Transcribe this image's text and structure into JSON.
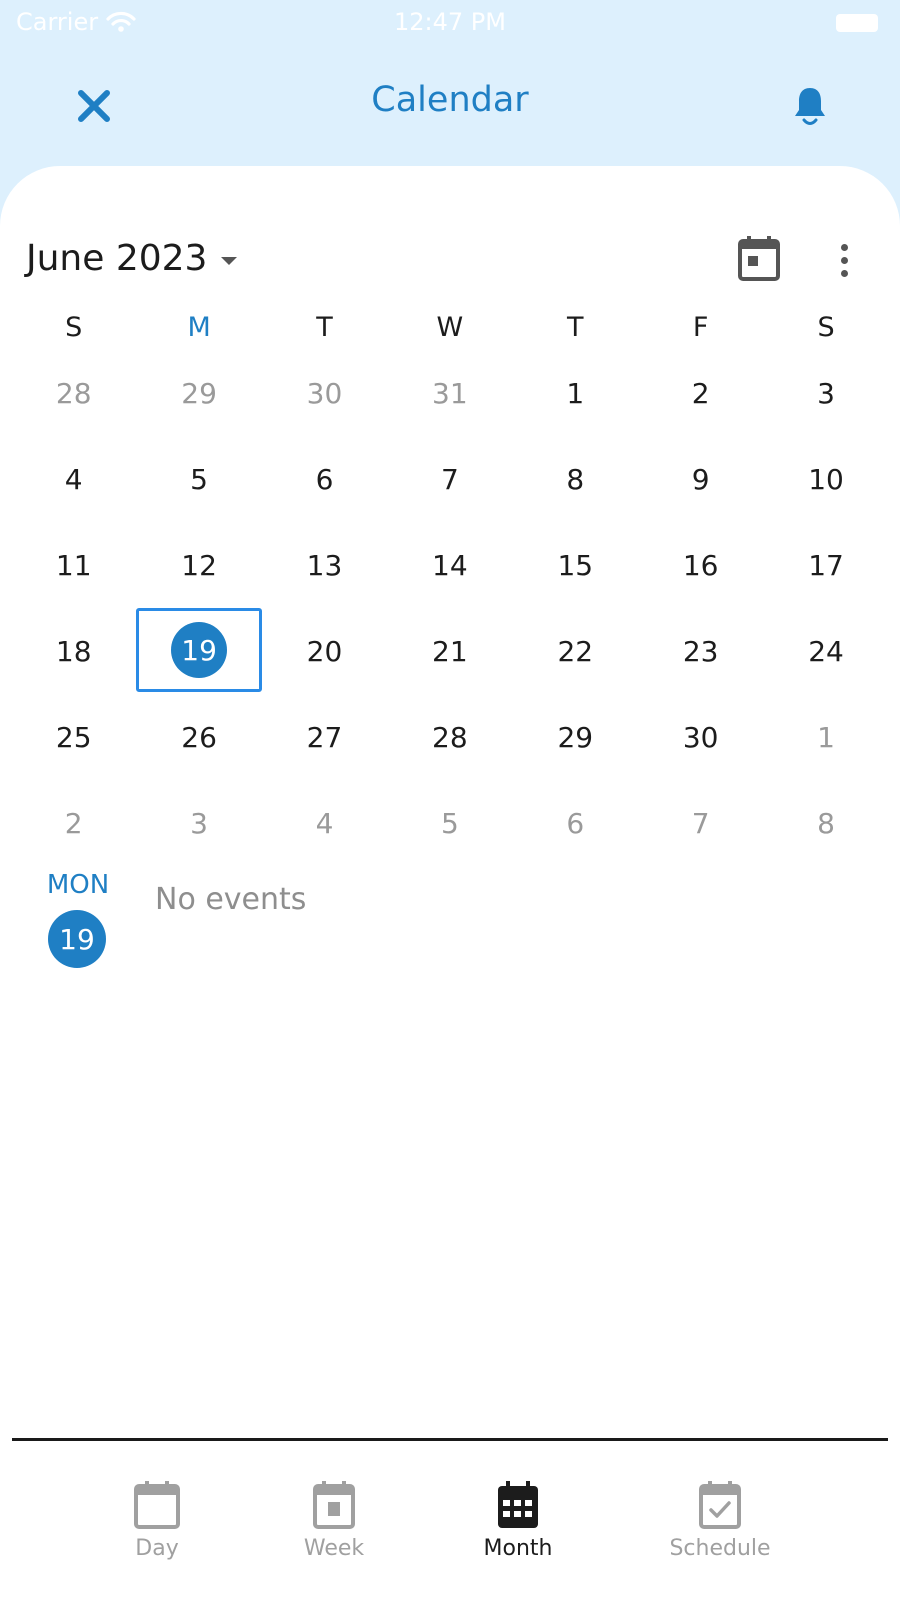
{
  "status_bar": {
    "carrier": "Carrier",
    "time": "12:47 PM"
  },
  "header": {
    "title": "Calendar",
    "close_icon": "close-icon",
    "bell_icon": "bell-icon"
  },
  "calendar": {
    "month_label": "June 2023",
    "weekdays": [
      "S",
      "M",
      "T",
      "W",
      "T",
      "F",
      "S"
    ],
    "today_weekday_index": 1,
    "weeks": [
      [
        {
          "d": "28",
          "m": true
        },
        {
          "d": "29",
          "m": true
        },
        {
          "d": "30",
          "m": true
        },
        {
          "d": "31",
          "m": true
        },
        {
          "d": "1",
          "m": false
        },
        {
          "d": "2",
          "m": false
        },
        {
          "d": "3",
          "m": false
        }
      ],
      [
        {
          "d": "4",
          "m": false
        },
        {
          "d": "5",
          "m": false
        },
        {
          "d": "6",
          "m": false
        },
        {
          "d": "7",
          "m": false
        },
        {
          "d": "8",
          "m": false
        },
        {
          "d": "9",
          "m": false
        },
        {
          "d": "10",
          "m": false
        }
      ],
      [
        {
          "d": "11",
          "m": false
        },
        {
          "d": "12",
          "m": false
        },
        {
          "d": "13",
          "m": false
        },
        {
          "d": "14",
          "m": false
        },
        {
          "d": "15",
          "m": false
        },
        {
          "d": "16",
          "m": false
        },
        {
          "d": "17",
          "m": false
        }
      ],
      [
        {
          "d": "18",
          "m": false
        },
        {
          "d": "19",
          "m": false,
          "today": true
        },
        {
          "d": "20",
          "m": false
        },
        {
          "d": "21",
          "m": false
        },
        {
          "d": "22",
          "m": false
        },
        {
          "d": "23",
          "m": false
        },
        {
          "d": "24",
          "m": false
        }
      ],
      [
        {
          "d": "25",
          "m": false
        },
        {
          "d": "26",
          "m": false
        },
        {
          "d": "27",
          "m": false
        },
        {
          "d": "28",
          "m": false
        },
        {
          "d": "29",
          "m": false
        },
        {
          "d": "30",
          "m": false
        },
        {
          "d": "1",
          "m": true
        }
      ],
      [
        {
          "d": "2",
          "m": true
        },
        {
          "d": "3",
          "m": true
        },
        {
          "d": "4",
          "m": true
        },
        {
          "d": "5",
          "m": true
        },
        {
          "d": "6",
          "m": true
        },
        {
          "d": "7",
          "m": true
        },
        {
          "d": "8",
          "m": true
        }
      ]
    ]
  },
  "agenda": {
    "weekday": "MON",
    "day": "19",
    "empty_text": "No events"
  },
  "tabs": [
    {
      "label": "Day",
      "icon": "day-calendar-icon",
      "active": false
    },
    {
      "label": "Week",
      "icon": "week-calendar-icon",
      "active": false
    },
    {
      "label": "Month",
      "icon": "month-calendar-icon",
      "active": true
    },
    {
      "label": "Schedule",
      "icon": "schedule-calendar-icon",
      "active": false
    }
  ],
  "colors": {
    "accent": "#1f7fc4",
    "header_bg": "#ddf0fd",
    "selection_border": "#2a8be6",
    "muted_text": "#9a9a9a"
  }
}
